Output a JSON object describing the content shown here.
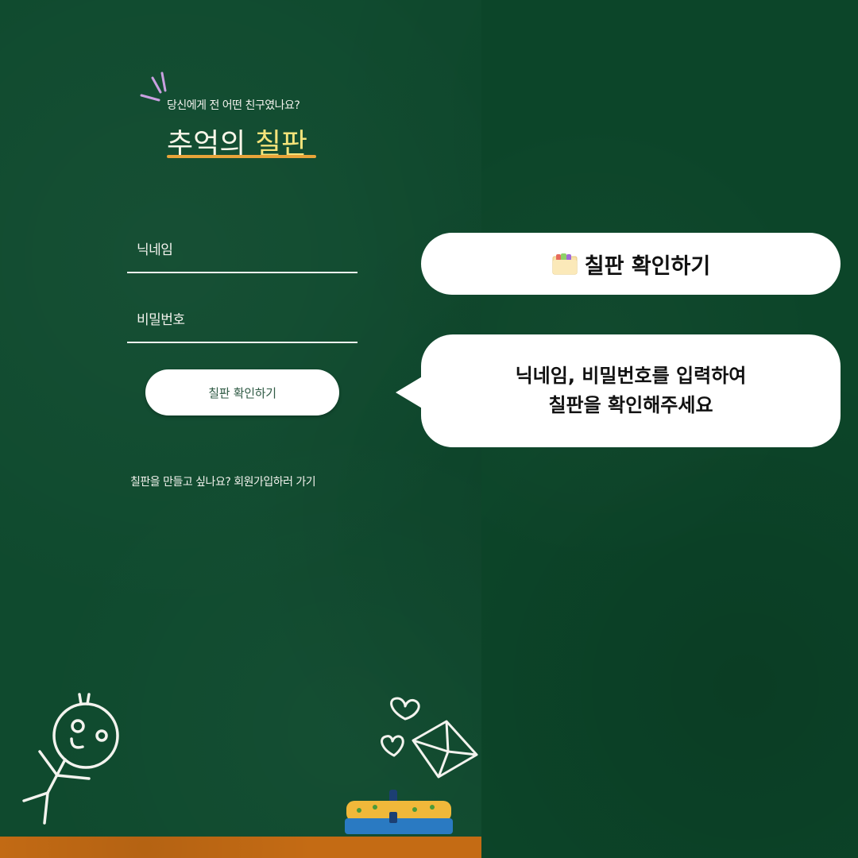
{
  "login": {
    "subtitle": "당신에게 전 어떤 친구였나요?",
    "title_part1": "추억의 ",
    "title_part2": "칠판",
    "nickname_label": "닉네임",
    "password_label": "비밀번호",
    "submit_label": "칠판 확인하기",
    "signup_link": "칠판을 만들고 싶나요? 회원가입하러 가기"
  },
  "callouts": {
    "heading": "칠판 확인하기",
    "heading_icon": "folder-icon",
    "instruction_line1": "닉네임, 비밀번호를 입력하여",
    "instruction_line2": "칠판을 확인해주세요"
  },
  "colors": {
    "chalkboard": "#0f4a2e",
    "title_accent": "#f4e37a",
    "underline": "#e8a43a",
    "floor": "#c46b14"
  }
}
